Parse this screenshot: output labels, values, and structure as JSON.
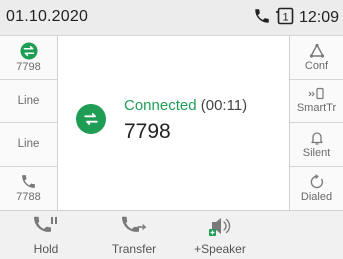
{
  "status_bar": {
    "date": "01.10.2020",
    "line_indicator": "1",
    "time": "12:09",
    "icons": [
      "phone-icon",
      "line-key-icon"
    ]
  },
  "left_keys": [
    {
      "label": "7798",
      "icon": "transfer-arrows-icon",
      "state": "active"
    },
    {
      "label": "Line"
    },
    {
      "label": "Line"
    },
    {
      "label": "7788",
      "icon": "phone-icon"
    }
  ],
  "right_keys": [
    {
      "label": "Conf",
      "icon": "conference-icon"
    },
    {
      "label": "SmartTr",
      "icon": "smart-transfer-icon"
    },
    {
      "label": "Silent",
      "icon": "bell-icon"
    },
    {
      "label": "Dialed",
      "icon": "redial-icon"
    }
  ],
  "call": {
    "status": "Connected",
    "duration": "(00:11)",
    "number": "7798",
    "icon": "transfer-arrows-icon"
  },
  "soft_keys": [
    {
      "label": "Hold",
      "icon": "hold-icon"
    },
    {
      "label": "Transfer",
      "icon": "transfer-phone-icon"
    },
    {
      "label": "+Speaker",
      "icon": "speaker-icon"
    }
  ],
  "colors": {
    "accent_green": "#1f9d55",
    "icon_gray": "#7a7a7a",
    "status_bar_bg": "#ececec"
  }
}
